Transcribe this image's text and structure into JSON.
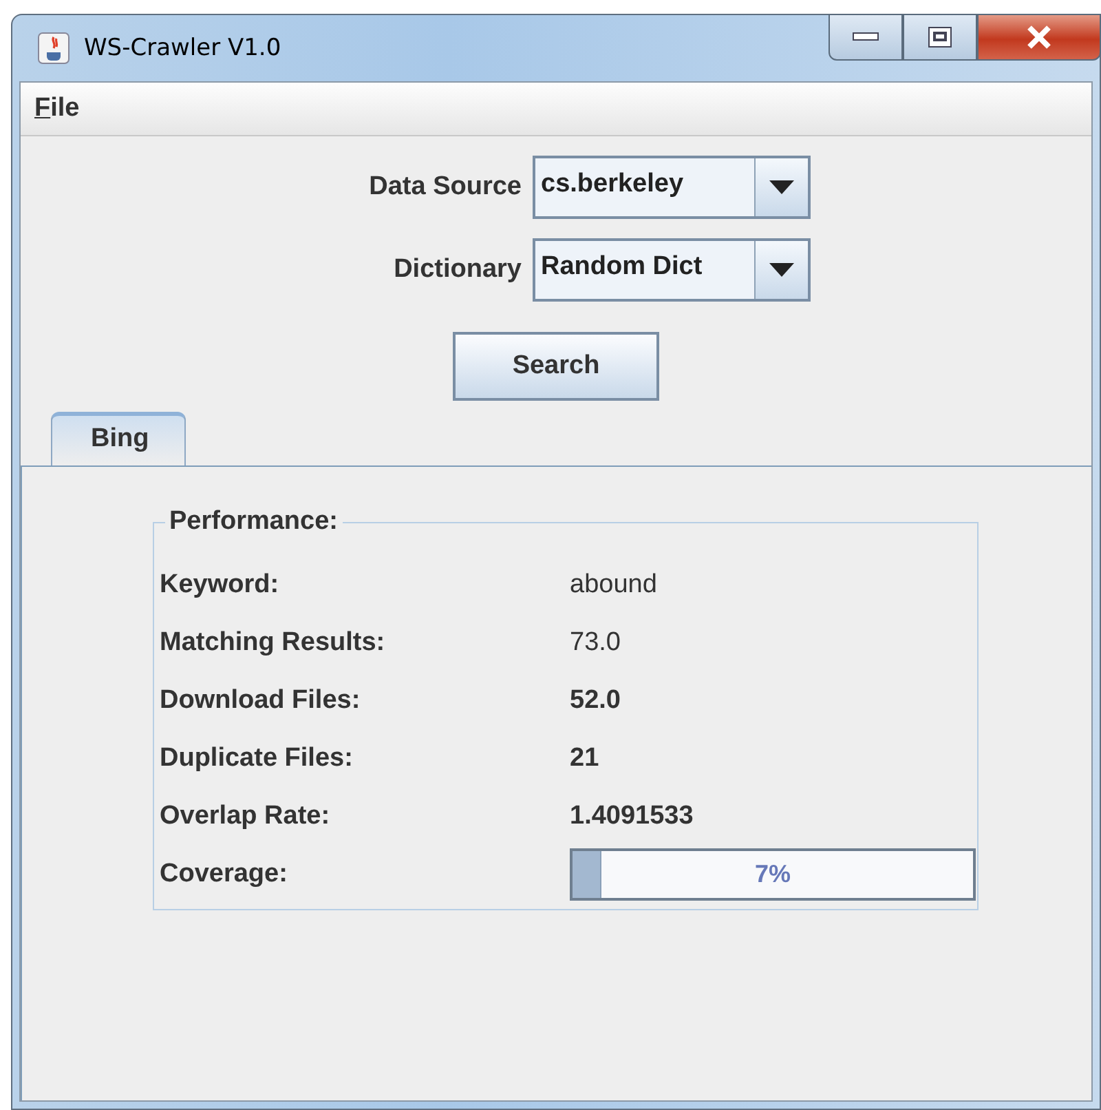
{
  "window": {
    "title": "WS-Crawler V1.0"
  },
  "menu": [
    {
      "label": "File"
    }
  ],
  "form": [
    {
      "label": "Data Source",
      "value": "cs.berkeley"
    },
    {
      "label": "Dictionary",
      "value": "Random Dict"
    }
  ],
  "search_button": "Search",
  "tabs": [
    {
      "label": "Bing",
      "selected": true
    }
  ],
  "performance": {
    "title": "Performance:",
    "rows": [
      {
        "label": "Keyword:",
        "value": "abound",
        "bold": false
      },
      {
        "label": "Matching Results:",
        "value": "73.0",
        "bold": false
      },
      {
        "label": "Download Files:",
        "value": "52.0",
        "bold": true
      },
      {
        "label": "Duplicate Files:",
        "value": "21",
        "bold": true
      },
      {
        "label": "Overlap Rate:",
        "value": "1.4091533",
        "bold": true
      }
    ],
    "coverage": {
      "label": "Coverage:",
      "level": 0.07,
      "reading": "7%"
    }
  }
}
